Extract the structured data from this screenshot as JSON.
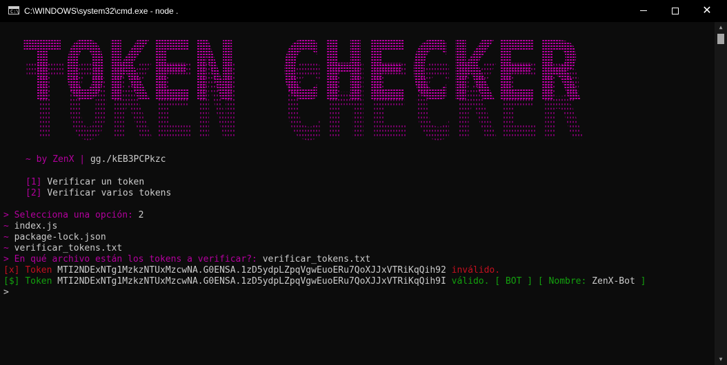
{
  "window": {
    "title": "C:\\WINDOWS\\system32\\cmd.exe - node  .",
    "minimize": "—",
    "close": "✕"
  },
  "banner": {
    "text": "TOKEN CHECKER",
    "color": "#b4009e"
  },
  "credits": {
    "prefix": "~ by ZenX",
    "sep": "|",
    "link": "gg./kEB3PCPkzc"
  },
  "menu": [
    {
      "num": "[1]",
      "label": "Verificar un token"
    },
    {
      "num": "[2]",
      "label": "Verificar varios tokens"
    }
  ],
  "prompt1": {
    "arrow": ">",
    "text": "Selecciona una opción:",
    "value": "2"
  },
  "files": [
    "index.js",
    "package-lock.json",
    "verificar_tokens.txt"
  ],
  "file_prefix": "~",
  "prompt2": {
    "arrow": ">",
    "text": "En qué archivo están los tokens a verificar?:",
    "value": "verificar_tokens.txt"
  },
  "result_invalid": {
    "tag": "[x]",
    "label": "Token",
    "token": "MTI2NDExNTg1MzkzNTUxMzcwNA.G0ENSA.1zD5ydpLZpqVgwEuoERu7QoXJJxVTRiKqQih92",
    "status": "inválido."
  },
  "result_valid": {
    "tag": "[$]",
    "label": "Token",
    "token": "MTI2NDExNTg1MzkzNTUxMzcwNA.G0ENSA.1zD5ydpLZpqVgwEuoERu7QoXJJxVTRiKqQih9I",
    "status": "válido.",
    "bot_open": "[",
    "bot": "BOT",
    "bot_close": "]",
    "name_open": "[",
    "name_label": "Nombre:",
    "name": "ZenX-Bot",
    "name_close": "]"
  },
  "cursor": ">",
  "colors": {
    "magenta": "#b4009e",
    "red": "#c50f1f",
    "green": "#13a10e",
    "fg": "#cccccc",
    "bg": "#0c0c0c"
  }
}
